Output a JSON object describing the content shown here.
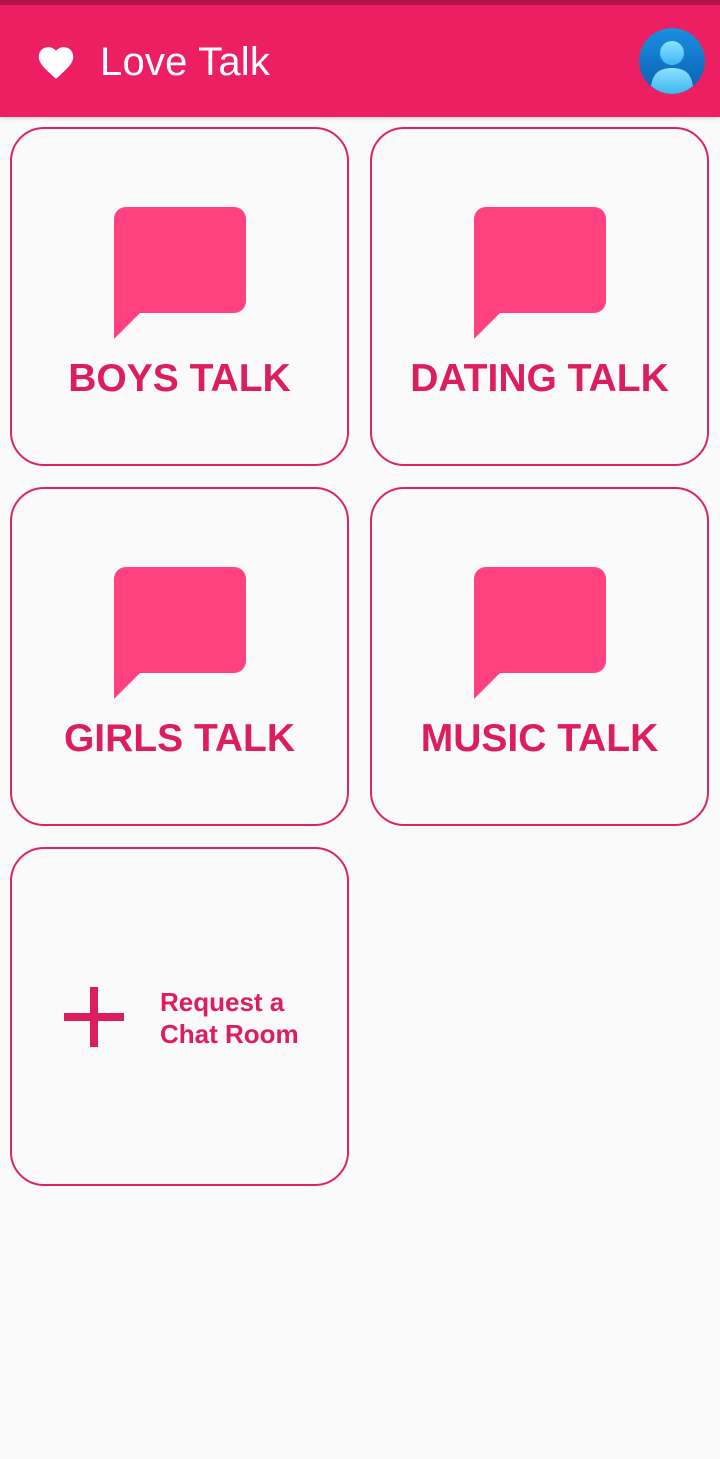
{
  "app": {
    "title": "Love Talk",
    "icons": {
      "logo": "heart-icon",
      "profile": "user-avatar-icon"
    }
  },
  "rooms": [
    {
      "label": "BOYS TALK",
      "icon": "chat-bubble-icon"
    },
    {
      "label": "DATING TALK",
      "icon": "chat-bubble-icon"
    },
    {
      "label": "GIRLS TALK",
      "icon": "chat-bubble-icon"
    },
    {
      "label": "MUSIC TALK",
      "icon": "chat-bubble-icon"
    }
  ],
  "request": {
    "label": "Request a\nChat Room",
    "icon": "plus-icon"
  },
  "colors": {
    "appbar": "#ec1f63",
    "statusbar": "#b5124a",
    "accent": "#dc1d5e",
    "bubble": "#ff427f",
    "background": "#fafafa"
  }
}
